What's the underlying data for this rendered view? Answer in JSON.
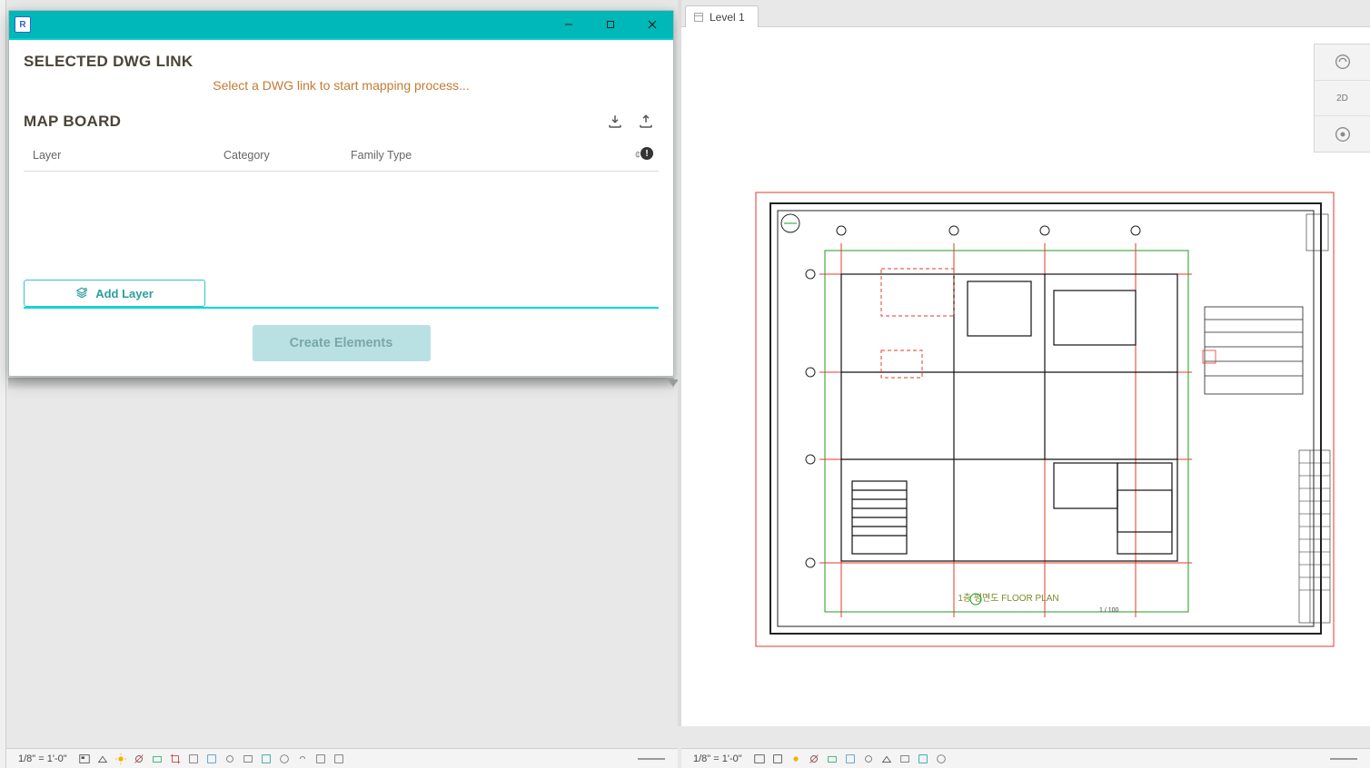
{
  "dialog": {
    "icon_letter": "R",
    "section1_title": "SELECTED DWG LINK",
    "hint": "Select a DWG link to start mapping process...",
    "section2_title": "MAP BOARD",
    "columns": {
      "layer": "Layer",
      "category": "Category",
      "family": "Family Type"
    },
    "info_prefix": "¢",
    "info_badge": "!",
    "add_layer_label": "Add Layer",
    "create_label": "Create Elements"
  },
  "right_tab": {
    "label": "Level 1"
  },
  "navcube": {
    "row1": "2D",
    "row2": ""
  },
  "viewbar": {
    "scale": "1/8\" = 1'-0\""
  },
  "plan": {
    "title_text": "1층 평면도 FLOOR PLAN",
    "scale_note": "1 / 100"
  }
}
